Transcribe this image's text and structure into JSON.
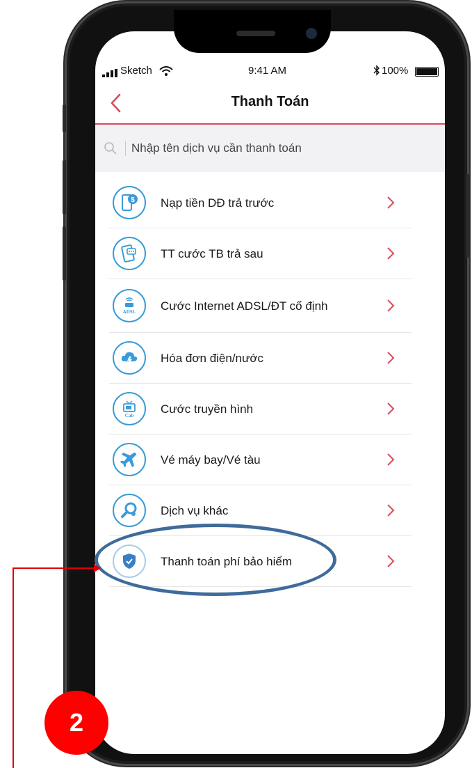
{
  "status_bar": {
    "carrier": "Sketch",
    "time": "9:41 AM",
    "battery": "100%"
  },
  "nav": {
    "title": "Thanh Toán",
    "back_icon": "chevron-left-icon"
  },
  "search": {
    "placeholder": "Nhập tên dịch vụ cần thanh toán"
  },
  "services": [
    {
      "label": "Nạp tiền DĐ trả trước",
      "icon": "phone-dollar-icon"
    },
    {
      "label": "TT cước TB trả sau",
      "icon": "phone-bill-icon"
    },
    {
      "label": "Cước Internet ADSL/ĐT cố định",
      "icon": "adsl-router-icon"
    },
    {
      "label": "Hóa đơn điện/nước",
      "icon": "cloud-bolt-icon"
    },
    {
      "label": "Cước truyền hình",
      "icon": "cable-tv-icon"
    },
    {
      "label": "Vé máy bay/Vé tàu",
      "icon": "airplane-icon"
    },
    {
      "label": "Dịch vụ khác",
      "icon": "magnifier-icon"
    },
    {
      "label": "Thanh toán phí bảo hiểm",
      "icon": "shield-check-icon"
    }
  ],
  "icon_text": {
    "adsl": "ADSL",
    "cab": "Cab"
  },
  "annotation": {
    "step": "2"
  },
  "colors": {
    "accent_red": "#d94b5a",
    "icon_blue": "#3a9bd8",
    "highlight": "#3f6b9b",
    "badge": "#ff0000"
  }
}
